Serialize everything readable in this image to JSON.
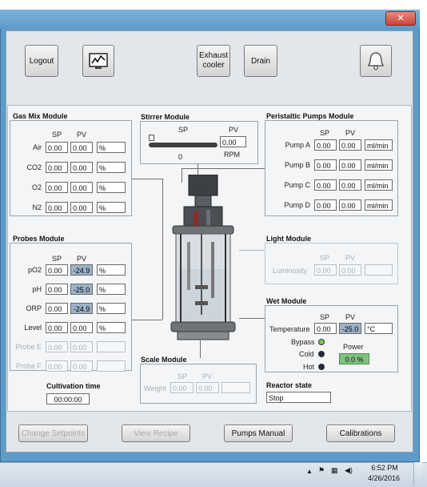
{
  "window": {
    "close_icon": "close-icon"
  },
  "toolbar": {
    "logout": "Logout",
    "monitor_icon": "chart-monitor-icon",
    "exhaust": "Exhaust cooler",
    "drain": "Drain",
    "bell_icon": "bell-icon"
  },
  "gas_mix": {
    "title": "Gas Mix Module",
    "sp": "SP",
    "pv": "PV",
    "rows": [
      {
        "label": "Air",
        "sp": "0.00",
        "pv": "0.00",
        "unit": "%"
      },
      {
        "label": "CO2",
        "sp": "0.00",
        "pv": "0.00",
        "unit": "%"
      },
      {
        "label": "O2",
        "sp": "0.00",
        "pv": "0.00",
        "unit": "%"
      },
      {
        "label": "N2",
        "sp": "0.00",
        "pv": "0.00",
        "unit": "%"
      }
    ]
  },
  "stirrer": {
    "title": "Stirrer Module",
    "sp": "SP",
    "pv": "PV",
    "pv_value": "0.00",
    "slider_value": "0",
    "unit": "RPM",
    "slider_fraction": 0
  },
  "pumps": {
    "title": "Peristaltic Pumps Module",
    "sp": "SP",
    "pv": "PV",
    "rows": [
      {
        "label": "Pump A",
        "sp": "0.00",
        "pv": "0.00",
        "unit": "ml/min"
      },
      {
        "label": "Pump B",
        "sp": "0.00",
        "pv": "0.00",
        "unit": "ml/min"
      },
      {
        "label": "Pump C",
        "sp": "0.00",
        "pv": "0.00",
        "unit": "ml/min"
      },
      {
        "label": "Pump D",
        "sp": "0.00",
        "pv": "0.00",
        "unit": "ml/min"
      }
    ]
  },
  "probes": {
    "title": "Probes Module",
    "sp": "SP",
    "pv": "PV",
    "rows": [
      {
        "label": "pO2",
        "sp": "0.00",
        "pv": "-24.9",
        "unit": "%"
      },
      {
        "label": "pH",
        "sp": "0.00",
        "pv": "-25.0",
        "unit": "%"
      },
      {
        "label": "ORP",
        "sp": "0.00",
        "pv": "-24.9",
        "unit": "%"
      },
      {
        "label": "Level",
        "sp": "0.00",
        "pv": "0.00",
        "unit": "%"
      },
      {
        "label": "Probe E",
        "sp": "0.00",
        "pv": "0.00",
        "unit": ""
      },
      {
        "label": "Probe F",
        "sp": "0.00",
        "pv": "0.00",
        "unit": ""
      }
    ]
  },
  "light": {
    "title": "Light Module",
    "sp": "SP",
    "pv": "PV",
    "label": "Luminosity",
    "sp_value": "0.00",
    "pv_value": "0.00"
  },
  "wet": {
    "title": "Wet Module",
    "sp": "SP",
    "pv": "PV",
    "temp_label": "Temperature",
    "temp_sp": "0.00",
    "temp_pv": "-25.0",
    "temp_unit": "°C",
    "bypass": "Bypass",
    "cold": "Cold",
    "hot": "Hot",
    "power_label": "Power",
    "power_value": "0.0 %",
    "bypass_color": "#7cc35a",
    "off_color": "#1e2a38"
  },
  "scale": {
    "title": "Scale Module",
    "sp": "SP",
    "pv": "PV",
    "label": "Weight",
    "sp_value": "0.00",
    "pv_value": "0.00"
  },
  "cultivation": {
    "label": "Cultivation time",
    "value": "00:00:00"
  },
  "reactor": {
    "label": "Reactor state",
    "value": "Stop"
  },
  "bottom": {
    "change_setpoints": "Change Setpoints",
    "view_recipe": "View Recipe",
    "pumps_manual": "Pumps Manual",
    "calibrations": "Calibrations"
  },
  "taskbar": {
    "time": "6:52 PM",
    "date": "4/26/2016"
  }
}
